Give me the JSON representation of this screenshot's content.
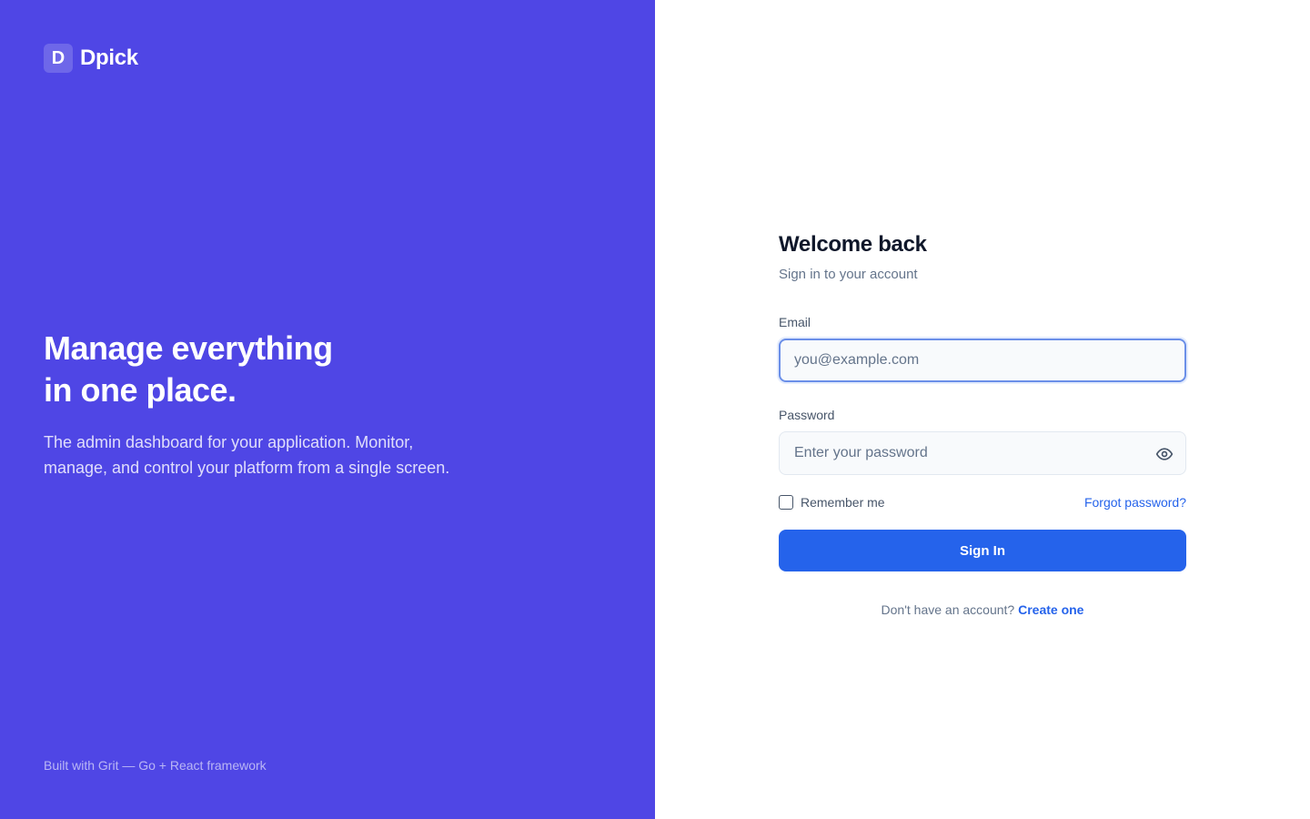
{
  "brand": {
    "logo_letter": "D",
    "name": "Dpick",
    "hero_title": "Manage everything\nin one place.",
    "hero_description": "The admin dashboard for your application. Monitor, manage, and control your platform from a single screen.",
    "footer": "Built with Grit — Go + React framework",
    "background_color": "#4f46e5"
  },
  "form": {
    "title": "Welcome back",
    "subtitle": "Sign in to your account",
    "email": {
      "label": "Email",
      "placeholder": "you@example.com",
      "value": ""
    },
    "password": {
      "label": "Password",
      "placeholder": "Enter your password",
      "value": "",
      "toggle_icon": "eye-icon"
    },
    "remember_label": "Remember me",
    "remember_checked": false,
    "forgot_link": "Forgot password?",
    "submit_label": "Sign In",
    "signup_prompt": "Don't have an account?",
    "signup_link": "Create one",
    "accent_color": "#2563eb"
  }
}
